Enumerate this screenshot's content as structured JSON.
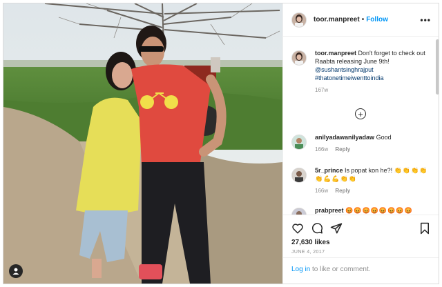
{
  "post": {
    "username": "toor.manpreet",
    "separator": "•",
    "follow_label": "Follow",
    "more_label": "•••",
    "caption": {
      "text": "Don't forget to check out Raabta releasing June 9th!",
      "mention": "@sushantsinghrajput",
      "hashtag": "#thatonetimeiwenttoindia",
      "age": "167w"
    },
    "load_more_icon": "plus-circle-icon",
    "likes": "27,630 likes",
    "date": "JUNE 4, 2017"
  },
  "comments": [
    {
      "user": "anilyadawanilyadaw",
      "text": "Good",
      "age": "166w",
      "reply_label": "Reply"
    },
    {
      "user": "5r_prince",
      "text": "Is popat kon he?!",
      "emoji_text": "👏👏👏👏👏💪💪👏👏",
      "age": "166w",
      "reply_label": "Reply"
    },
    {
      "user": "prabpreet",
      "emoji_text": "😡😡😡😡😡😡😡😡"
    }
  ],
  "actions": {
    "icons": [
      "heart-icon",
      "comment-icon",
      "share-icon",
      "bookmark-icon"
    ]
  },
  "login": {
    "link_label": "Log in",
    "suffix": " to like or comment."
  },
  "colors": {
    "accent": "#0095f6",
    "text": "#262626",
    "muted": "#8e8e8e",
    "border": "#dbdbdb"
  }
}
